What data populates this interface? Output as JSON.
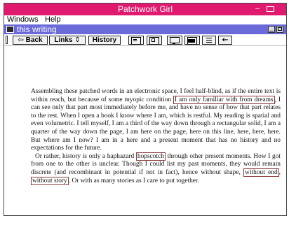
{
  "app": {
    "title": "Patchwork Girl"
  },
  "menu": [
    "Windows",
    "Help"
  ],
  "document": {
    "title": "this writing"
  },
  "toolbar": {
    "back_label": "Back",
    "links_label": "Links",
    "history_label": "History",
    "icons": [
      "page-icon",
      "page-icon",
      "monitor-icon",
      "window-icon",
      "list-icon",
      "arrow-icon"
    ]
  },
  "text": {
    "p1_pre": "Assembling these patched words in an electronic space, I feel half-blind, as if the entire text is within reach, but because of some myopic condition ",
    "p1_link": "I am only familiar with from dreams",
    "p1_post": ", I can see only that part most immediately before me, and have no sense of how that part relates to the rest. When I open a book I know where I am, which is restful. My reading is spatial and even volumetric. I tell myself, I am a third of the way down through a rectangular solid, I am a quarter of the way down the page, I am here on the page, here on this line, here, here, here. But where am I now? I am in a here and a present moment that has no history and no expectations for the future.",
    "p2_pre": "Or rather, history is only a haphazard ",
    "p2_link1": "hopscotch",
    "p2_mid": " through other present moments. How I got from one to the other is unclear. Though I could list my past moments, they would remain discrete (and recombinant in potential if not in fact), hence without shape, ",
    "p2_link2": "without end",
    "p2_sep": ", ",
    "p2_link3": "without story",
    "p2_post": ". Or with as many stories as I care to put together."
  },
  "colors": {
    "title_bar": "#e01b6f",
    "doc_title_bar": "#6a6ad8",
    "link_border": "#8a3a3a"
  }
}
